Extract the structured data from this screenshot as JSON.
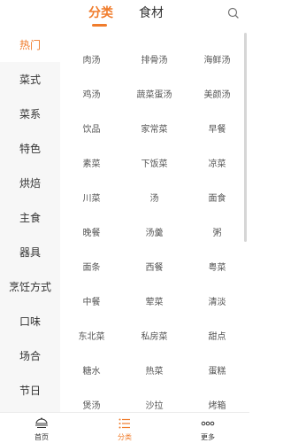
{
  "header": {
    "tab_category": "分类",
    "tab_ingredients": "食材",
    "search_icon": "search-icon"
  },
  "sidebar": {
    "items": [
      {
        "label": "热门",
        "active": true
      },
      {
        "label": "菜式",
        "active": false
      },
      {
        "label": "菜系",
        "active": false
      },
      {
        "label": "特色",
        "active": false
      },
      {
        "label": "烘焙",
        "active": false
      },
      {
        "label": "主食",
        "active": false
      },
      {
        "label": "器具",
        "active": false
      },
      {
        "label": "烹饪方式",
        "active": false
      },
      {
        "label": "口味",
        "active": false
      },
      {
        "label": "场合",
        "active": false
      },
      {
        "label": "节日",
        "active": false
      }
    ]
  },
  "grid": {
    "items": [
      "肉汤",
      "排骨汤",
      "海鲜汤",
      "鸡汤",
      "蔬菜蛋汤",
      "美颜汤",
      "饮品",
      "家常菜",
      "早餐",
      "素菜",
      "下饭菜",
      "凉菜",
      "川菜",
      "汤",
      "面食",
      "晚餐",
      "汤羹",
      "粥",
      "面条",
      "西餐",
      "粤菜",
      "中餐",
      "荤菜",
      "清淡",
      "东北菜",
      "私房菜",
      "甜点",
      "糖水",
      "热菜",
      "蛋糕",
      "煲汤",
      "沙拉",
      "烤箱"
    ]
  },
  "bottom_nav": {
    "items": [
      {
        "label": "首页",
        "icon": "home-icon",
        "active": false
      },
      {
        "label": "分类",
        "icon": "list-icon",
        "active": true
      },
      {
        "label": "更多",
        "icon": "more-icon",
        "active": false
      }
    ]
  },
  "colors": {
    "accent": "#f07c2c",
    "sidebar_bg": "#f7f7f7",
    "text": "#333333"
  }
}
